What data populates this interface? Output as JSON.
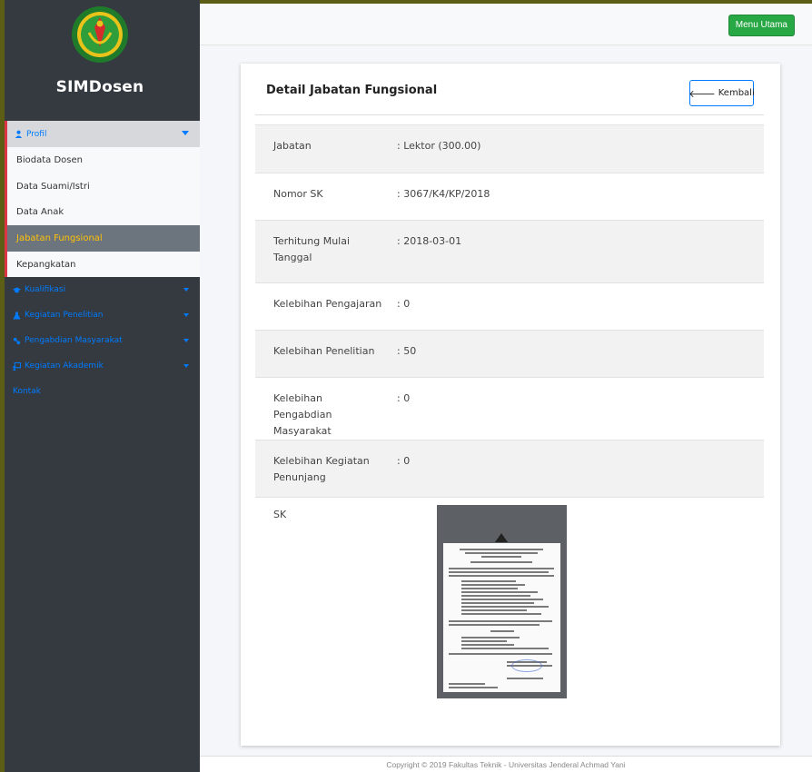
{
  "brand": {
    "name": "SIMDosen",
    "logo": "university-logo"
  },
  "sidebar": {
    "profil": {
      "label": "Profil",
      "items": [
        {
          "label": "Biodata Dosen",
          "active": false
        },
        {
          "label": "Data Suami/Istri",
          "active": false
        },
        {
          "label": "Data Anak",
          "active": false
        },
        {
          "label": "Jabatan Fungsional",
          "active": true
        },
        {
          "label": "Kepangkatan",
          "active": false
        }
      ]
    },
    "menu": [
      {
        "label": "Kualifikasi",
        "icon": "graduation-cap-icon"
      },
      {
        "label": "Kegiatan Penelitian",
        "icon": "flask-icon"
      },
      {
        "label": "Pengabdian Masyarakat",
        "icon": "handshake-icon"
      },
      {
        "label": "Kegiatan Akademik",
        "icon": "chalkboard-icon"
      },
      {
        "label": "Kontak",
        "icon": ""
      }
    ]
  },
  "header": {
    "menu_button": "Menu Utama"
  },
  "card": {
    "title": "Detail Jabatan Fungsional",
    "back_button": "Kembali",
    "rows": [
      {
        "label": "Jabatan",
        "value": ": Lektor (300.00)"
      },
      {
        "label": "Nomor SK",
        "value": ": 3067/K4/KP/2018"
      },
      {
        "label": "Terhitung Mulai Tanggal",
        "value": ": 2018-03-01"
      },
      {
        "label": "Kelebihan Pengajaran",
        "value": ": 0"
      },
      {
        "label": "Kelebihan Penelitian",
        "value": ": 50"
      },
      {
        "label": "Kelebihan Pengabdian Masyarakat",
        "value": ": 0"
      },
      {
        "label": "Kelebihan Kegiatan Penunjang",
        "value": ": 0"
      },
      {
        "label": "SK",
        "value": ""
      }
    ]
  },
  "footer": {
    "text": "Copyright © 2019 Fakultas Teknik - Universitas Jenderal Achmad Yani"
  },
  "colors": {
    "sidebar": "#343a40",
    "link": "#007bff",
    "active_text": "#ffc107",
    "accent_red": "#dc3545",
    "success": "#28a745"
  }
}
